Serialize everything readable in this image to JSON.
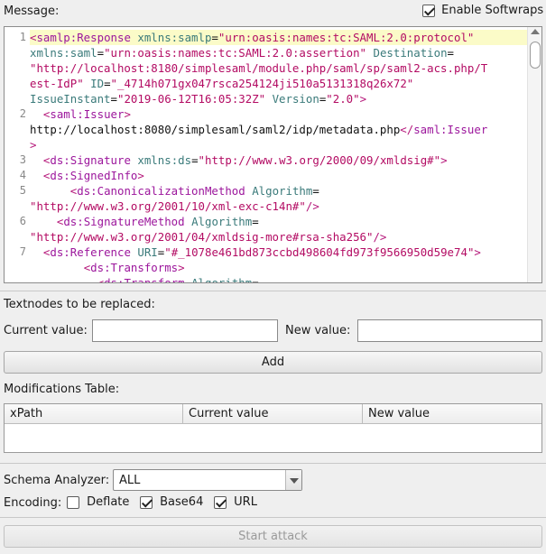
{
  "message_label": "Message:",
  "softwraps": {
    "label": "Enable Softwraps",
    "checked": true
  },
  "editor": {
    "lines": [
      {
        "n": "1",
        "rows": [
          [
            [
              "tag",
              "<"
            ],
            [
              "tname",
              "samlp:Response"
            ],
            [
              "txt",
              " "
            ],
            [
              "attr",
              "xmlns:samlp"
            ],
            [
              "txt",
              "="
            ],
            [
              "val",
              "\"urn:oasis:names:tc:SAML:2.0:protocol\""
            ]
          ],
          [
            [
              "attr",
              "xmlns:saml"
            ],
            [
              "txt",
              "="
            ],
            [
              "val",
              "\"urn:oasis:names:tc:SAML:2.0:assertion\""
            ],
            [
              "txt",
              " "
            ],
            [
              "attr",
              "Destination"
            ],
            [
              "txt",
              "="
            ]
          ],
          [
            [
              "val",
              "\"http://localhost:8180/simplesaml/module.php/saml/sp/saml2-acs.php/T"
            ]
          ],
          [
            [
              "val",
              "est-IdP\""
            ],
            [
              "txt",
              " "
            ],
            [
              "attr",
              "ID"
            ],
            [
              "txt",
              "="
            ],
            [
              "val",
              "\"_4714h071gx047rsca254124ji510a5131318q26x72\""
            ]
          ],
          [
            [
              "attr",
              "IssueInstant"
            ],
            [
              "txt",
              "="
            ],
            [
              "val",
              "\"2019-06-12T16:05:32Z\""
            ],
            [
              "txt",
              " "
            ],
            [
              "attr",
              "Version"
            ],
            [
              "txt",
              "="
            ],
            [
              "val",
              "\"2.0\""
            ],
            [
              "tag",
              ">"
            ]
          ]
        ]
      },
      {
        "n": "2",
        "rows": [
          [
            [
              "txt",
              "  "
            ],
            [
              "tag",
              "<"
            ],
            [
              "tname",
              "saml:Issuer"
            ],
            [
              "tag",
              ">"
            ]
          ],
          [
            [
              "txt",
              "http://localhost:8080/simplesaml/saml2/idp/metadata.php"
            ],
            [
              "tag",
              "</"
            ],
            [
              "tname",
              "saml:Issuer"
            ]
          ],
          [
            [
              "tag",
              ">"
            ]
          ]
        ]
      },
      {
        "n": "3",
        "rows": [
          [
            [
              "txt",
              "  "
            ],
            [
              "tag",
              "<"
            ],
            [
              "tname",
              "ds:Signature"
            ],
            [
              "txt",
              " "
            ],
            [
              "attr",
              "xmlns:ds"
            ],
            [
              "txt",
              "="
            ],
            [
              "val",
              "\"http://www.w3.org/2000/09/xmldsig#\""
            ],
            [
              "tag",
              ">"
            ]
          ]
        ]
      },
      {
        "n": "4",
        "rows": [
          [
            [
              "txt",
              "  "
            ],
            [
              "tag",
              "<"
            ],
            [
              "tname",
              "ds:SignedInfo"
            ],
            [
              "tag",
              ">"
            ]
          ]
        ]
      },
      {
        "n": "5",
        "rows": [
          [
            [
              "txt",
              "      "
            ],
            [
              "tag",
              "<"
            ],
            [
              "tname",
              "ds:CanonicalizationMethod"
            ],
            [
              "txt",
              " "
            ],
            [
              "attr",
              "Algorithm"
            ],
            [
              "txt",
              "="
            ]
          ],
          [
            [
              "val",
              "\"http://www.w3.org/2001/10/xml-exc-c14n#\""
            ],
            [
              "tag",
              "/>"
            ]
          ]
        ]
      },
      {
        "n": "6",
        "rows": [
          [
            [
              "txt",
              "    "
            ],
            [
              "tag",
              "<"
            ],
            [
              "tname",
              "ds:SignatureMethod"
            ],
            [
              "txt",
              " "
            ],
            [
              "attr",
              "Algorithm"
            ],
            [
              "txt",
              "="
            ]
          ],
          [
            [
              "val",
              "\"http://www.w3.org/2001/04/xmldsig-more#rsa-sha256\""
            ],
            [
              "tag",
              "/>"
            ]
          ]
        ]
      },
      {
        "n": "7",
        "rows": [
          [
            [
              "txt",
              "  "
            ],
            [
              "tag",
              "<"
            ],
            [
              "tname",
              "ds:Reference"
            ],
            [
              "txt",
              " "
            ],
            [
              "attr",
              "URI"
            ],
            [
              "txt",
              "="
            ],
            [
              "val",
              "\"#_1078e461bd873ccbd498604fd973f9566950d59e74\""
            ],
            [
              "tag",
              ">"
            ]
          ],
          [
            [
              "txt",
              "        "
            ],
            [
              "tag",
              "<"
            ],
            [
              "tname",
              "ds:Transforms"
            ],
            [
              "tag",
              ">"
            ]
          ],
          [
            [
              "txt",
              "          "
            ],
            [
              "tag",
              "<"
            ],
            [
              "tname",
              "ds:Transform"
            ],
            [
              "txt",
              " "
            ],
            [
              "attr",
              "Algorithm"
            ],
            [
              "txt",
              "="
            ]
          ]
        ]
      }
    ]
  },
  "textnodes_label": "Textnodes to be replaced:",
  "current_value": {
    "label": "Current value:",
    "value": ""
  },
  "new_value": {
    "label": "New value:",
    "value": ""
  },
  "add_button": "Add",
  "modifications_label": "Modifications Table:",
  "table_headers": [
    "xPath",
    "Current value",
    "New value"
  ],
  "schema": {
    "label": "Schema Analyzer:",
    "selected": "ALL"
  },
  "encoding": {
    "label": "Encoding:",
    "options": [
      {
        "label": "Deflate",
        "checked": false
      },
      {
        "label": "Base64",
        "checked": true
      },
      {
        "label": "URL",
        "checked": true
      }
    ]
  },
  "start_button": "Start attack",
  "icons": {
    "checkbox": "checkbox-icon",
    "dropdown": "chevron-down-icon",
    "scroll": "scroll-up-arrow-icon"
  }
}
